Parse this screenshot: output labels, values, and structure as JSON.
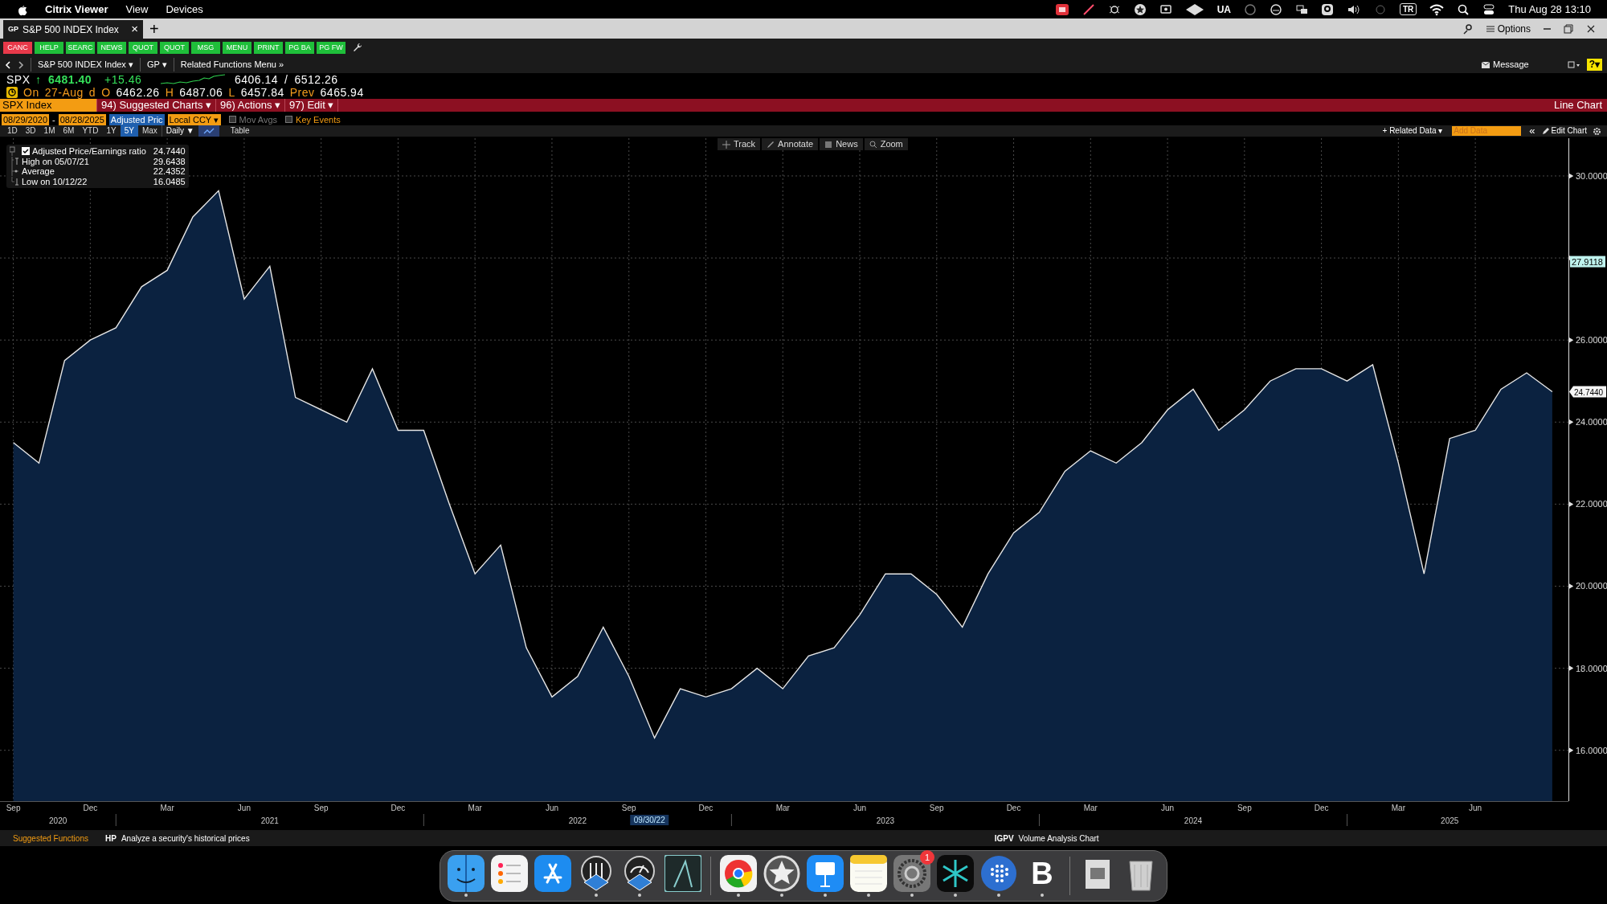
{
  "menubar": {
    "app": "Citrix Viewer",
    "menus": [
      "View",
      "Devices"
    ],
    "status_texts": [
      "UA",
      "TR"
    ],
    "clock": "Thu Aug 28  13:10"
  },
  "tab": {
    "badge": "GP",
    "title": "S&P 500 INDEX Index",
    "close": "×",
    "new": "+",
    "options": "Options"
  },
  "function_keys": [
    {
      "label": "CANC",
      "kind": "cancel"
    },
    {
      "label": "HELP",
      "kind": "go"
    },
    {
      "label": "SEARC",
      "kind": "go"
    },
    {
      "label": "NEWS",
      "kind": "go"
    },
    {
      "label": "QUOT",
      "kind": "go"
    },
    {
      "label": "QUOT",
      "kind": "go"
    },
    {
      "label": "MSG",
      "kind": "go"
    },
    {
      "label": "MENU",
      "kind": "go"
    },
    {
      "label": "PRINT",
      "kind": "go"
    },
    {
      "label": "PG BA",
      "kind": "go"
    },
    {
      "label": "PG FW",
      "kind": "go"
    }
  ],
  "nav": {
    "security": "S&P 500 INDEX Index ▾",
    "function": "GP ▾",
    "related": "Related Functions Menu »",
    "message": "Message",
    "help": "?▾"
  },
  "quote": {
    "ticker": "SPX",
    "arrow": "↑",
    "last": "6481.40",
    "change": "+15.46",
    "range_low": "6406.14",
    "range_sep": "/",
    "range_high": "6512.26",
    "on_label": "On",
    "date": "27-Aug",
    "date_flag": "d",
    "open_label": "O",
    "open": "6462.26",
    "high_label": "H",
    "high": "6487.06",
    "low_label": "L",
    "low": "6457.84",
    "prev_label": "Prev",
    "prev": "6465.94"
  },
  "title_bar": {
    "security": "SPX Index",
    "menus": [
      {
        "number": "94)",
        "label": "Suggested Charts ▾"
      },
      {
        "number": "96)",
        "label": "Actions ▾"
      },
      {
        "number": "97)",
        "label": "Edit ▾"
      }
    ],
    "chart_type": "Line Chart"
  },
  "settings": {
    "start_date": "08/29/2020",
    "dash": "-",
    "end_date": "08/28/2025",
    "field": "Adjusted Pric",
    "currency": "Local CCY ▾",
    "options": [
      {
        "label": "Mov Avgs",
        "checked": false,
        "kind": "muted"
      },
      {
        "label": "Key Events",
        "checked": false,
        "kind": "accent"
      }
    ]
  },
  "periods": [
    {
      "label": "1D",
      "selected": false
    },
    {
      "label": "3D",
      "selected": false
    },
    {
      "label": "1M",
      "selected": false
    },
    {
      "label": "6M",
      "selected": false
    },
    {
      "label": "YTD",
      "selected": false
    },
    {
      "label": "1Y",
      "selected": false
    },
    {
      "label": "5Y",
      "selected": true
    },
    {
      "label": "Max",
      "selected": false
    }
  ],
  "frequency": "Daily ▼",
  "views": [
    {
      "kind": "chart",
      "selected": true
    },
    {
      "kind": "table",
      "label": "Table",
      "selected": false
    }
  ],
  "right_tools": {
    "related_data": "+ Related Data ▾",
    "add_data_placeholder": "Add Data",
    "collapse": "«",
    "edit_chart": "Edit Chart"
  },
  "chart_tools": [
    "Track",
    "Annotate",
    "News",
    "Zoom"
  ],
  "legend": [
    {
      "kind": "series",
      "value": "24.7440",
      "checked": true
    },
    {
      "kind": "high",
      "label": "High on 05/07/21",
      "value": "29.6438"
    },
    {
      "kind": "average",
      "label": "Average",
      "value": "22.4352"
    },
    {
      "kind": "low",
      "label": "Low on 10/12/22",
      "value": "16.0485"
    }
  ],
  "chart": {
    "chart_data": {
      "type": "area",
      "categories": [
        "Sep",
        null,
        null,
        "Dec",
        null,
        null,
        "Mar",
        null,
        null,
        "Jun",
        null,
        null,
        "Sep",
        null,
        null,
        "Dec",
        null,
        null,
        "Mar",
        null,
        null,
        "Jun",
        null,
        null,
        "Sep",
        null,
        null,
        "Dec",
        null,
        null,
        "Mar",
        null,
        null,
        "Jun",
        null,
        null,
        "Sep",
        null,
        null,
        "Dec",
        null,
        null,
        "Mar",
        null,
        null,
        "Jun",
        null,
        null,
        "Sep",
        null,
        null,
        "Dec",
        null,
        null,
        "Mar",
        null,
        null,
        "Jun",
        null,
        null,
        null
      ],
      "series": [
        {
          "name": "Adjusted Price/Earnings ratio",
          "color": "#e6e6e6",
          "values": [
            23.5,
            23.0,
            25.5,
            26.0,
            26.3,
            27.3,
            27.7,
            29.0,
            29.64,
            27.0,
            27.8,
            24.6,
            24.3,
            24.0,
            25.3,
            23.8,
            23.8,
            22.0,
            20.3,
            21.0,
            18.5,
            17.3,
            17.8,
            19.0,
            17.8,
            16.3,
            17.5,
            17.3,
            17.5,
            18.0,
            17.5,
            18.3,
            18.5,
            19.3,
            20.3,
            20.3,
            19.8,
            19.0,
            20.3,
            21.3,
            21.8,
            22.8,
            23.3,
            23.0,
            23.5,
            24.3,
            24.8,
            23.8,
            24.3,
            25.0,
            25.3,
            25.3,
            25.0,
            25.4,
            23.0,
            20.3,
            23.6,
            23.8,
            24.8,
            25.2,
            24.74
          ]
        }
      ],
      "grid": true,
      "ylim": [
        14.76,
        30.92
      ],
      "yticks": [
        {
          "value": 16,
          "label": "16.0000"
        },
        {
          "value": 18,
          "label": "18.0000"
        },
        {
          "value": 20,
          "label": "20.0000"
        },
        {
          "value": 22,
          "label": "22.0000"
        },
        {
          "value": 24,
          "label": "24.0000"
        },
        {
          "value": 26,
          "label": "26.0000"
        },
        {
          "value": 30,
          "label": "30.0000"
        }
      ]
    },
    "year_labels": [
      "2020",
      "2021",
      "2022",
      "2023",
      "2024",
      "2025"
    ],
    "crosshair": {
      "x_label": "09/30/22",
      "y_label": "27.9118"
    },
    "last_value_label": "24.7440"
  },
  "status_bar": {
    "suggested": "Suggested Functions",
    "items": [
      {
        "code": "HP",
        "text": "Analyze a security's historical prices"
      },
      {
        "code": "IGPV",
        "text": "Volume Analysis Chart"
      }
    ]
  },
  "dock": [
    {
      "kind": "finder",
      "running": true
    },
    {
      "kind": "reminders",
      "running": false
    },
    {
      "kind": "appstore",
      "running": false
    },
    {
      "kind": "sliders",
      "running": true
    },
    {
      "kind": "gauge",
      "running": true
    },
    {
      "kind": "peak",
      "running": false
    },
    {
      "kind": "divider"
    },
    {
      "kind": "chrome",
      "running": true
    },
    {
      "kind": "star",
      "running": true
    },
    {
      "kind": "keynote",
      "running": true
    },
    {
      "kind": "notes",
      "running": true
    },
    {
      "kind": "settings",
      "running": true,
      "badge": "1"
    },
    {
      "kind": "spark",
      "running": true
    },
    {
      "kind": "dots",
      "running": true
    },
    {
      "kind": "letter",
      "label": "B",
      "running": true
    },
    {
      "kind": "divider"
    },
    {
      "kind": "file",
      "running": false
    },
    {
      "kind": "trash",
      "running": false
    }
  ]
}
